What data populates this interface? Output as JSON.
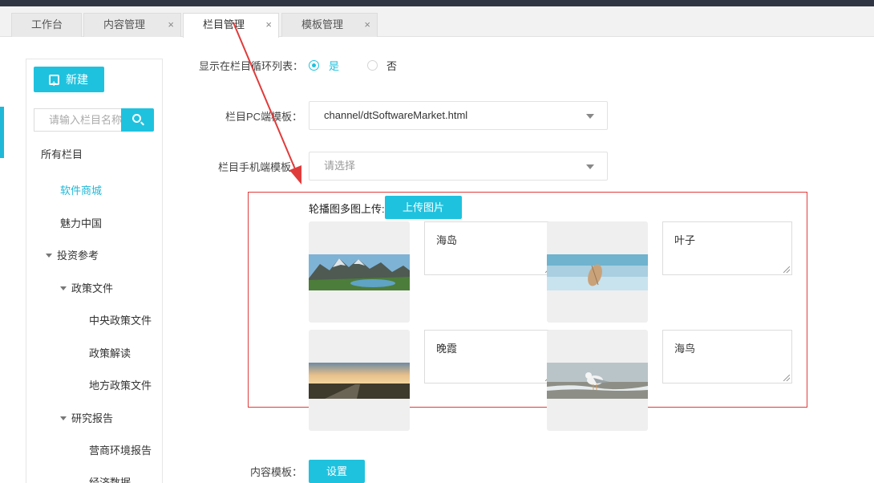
{
  "tabs": [
    {
      "label": "工作台",
      "closable": false
    },
    {
      "label": "内容管理",
      "closable": true
    },
    {
      "label": "栏目管理",
      "closable": true,
      "active": true
    },
    {
      "label": "模板管理",
      "closable": true
    }
  ],
  "sidebar": {
    "new_button": "新建",
    "search_placeholder": "请输入栏目名称",
    "tree": [
      {
        "label": "所有栏目"
      },
      {
        "label": "软件商城",
        "selected": true
      },
      {
        "label": "魅力中国"
      },
      {
        "label": "投资参考",
        "expanded": true
      },
      {
        "label": "政策文件",
        "expanded": true
      },
      {
        "label": "中央政策文件"
      },
      {
        "label": "政策解读"
      },
      {
        "label": "地方政策文件"
      },
      {
        "label": "研究报告",
        "expanded": true
      },
      {
        "label": "营商环境报告"
      },
      {
        "label": "经济数据"
      }
    ]
  },
  "form": {
    "show_in_loop_label": "显示在栏目循环列表：",
    "yes": "是",
    "no": "否",
    "pc_template_label": "栏目PC端模板：",
    "pc_template_value": "channel/dtSoftwareMarket.html",
    "mobile_template_label": "栏目手机端模板：",
    "mobile_template_placeholder": "请选择",
    "carousel_label": "轮播图多图上传:",
    "upload_button": "上传图片",
    "images": [
      {
        "caption": "海岛",
        "icon": "mountain-lake-image"
      },
      {
        "caption": "叶子",
        "icon": "leaf-in-water-image"
      },
      {
        "caption": "晚霞",
        "icon": "sunset-road-image"
      },
      {
        "caption": "海鸟",
        "icon": "seagull-image"
      }
    ],
    "content_template_label": "内容模板：",
    "set_button": "设置"
  },
  "colors": {
    "accent": "#1fc2de",
    "annotation_red": "#e03b3b"
  }
}
